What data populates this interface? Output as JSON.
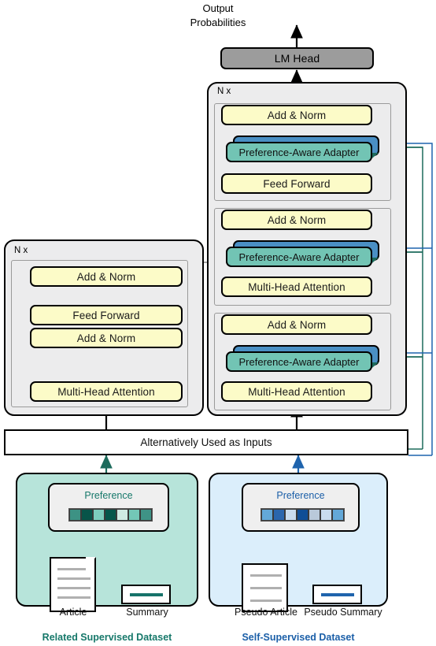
{
  "diagram": {
    "title_top_line1": "Output",
    "title_top_line2": "Probabilities",
    "lm_head": "LM Head",
    "encoder": {
      "repeat_label": "N x",
      "blocks": [
        {
          "label": "Add & Norm"
        },
        {
          "label": "Feed Forward"
        },
        {
          "label": "Add & Norm"
        },
        {
          "label": "Multi-Head Attention"
        }
      ]
    },
    "decoder": {
      "repeat_label": "N x",
      "blocks": [
        {
          "label": "Add & Norm",
          "kind": "norm"
        },
        {
          "label": "Preference-Aware Adapter",
          "kind": "adapter"
        },
        {
          "label": "Feed Forward",
          "kind": "ff"
        },
        {
          "label": "Add & Norm",
          "kind": "norm"
        },
        {
          "label": "Preference-Aware Adapter",
          "kind": "adapter"
        },
        {
          "label": "Multi-Head Attention",
          "kind": "attn"
        },
        {
          "label": "Add & Norm",
          "kind": "norm"
        },
        {
          "label": "Preference-Aware Adapter",
          "kind": "adapter"
        },
        {
          "label": "Multi-Head Attention",
          "kind": "attn"
        }
      ]
    },
    "input_bar": "Alternatively Used as Inputs",
    "datasets": [
      {
        "id": "related-supervised",
        "title": "Related Supervised Dataset",
        "title_color": "#16786a",
        "panel_color": "#b7e4da",
        "accent": "#1d6b5c",
        "preference_label": "Preference",
        "preference_values": [
          "#3d9284",
          "#075449",
          "#7dcdbd",
          "#05564a",
          "#cfeae3",
          "#73c7b7",
          "#3f9386"
        ],
        "left_caption": "Article",
        "right_caption": "Summary"
      },
      {
        "id": "self-supervised",
        "title": "Self-Supervised Dataset",
        "title_color": "#1b5fa8",
        "panel_color": "#dbeefb",
        "accent": "#1f64ad",
        "preference_label": "Preference",
        "preference_values": [
          "#63a8d8",
          "#2a66ad",
          "#c9dcee",
          "#0f4e96",
          "#b9c9da",
          "#c9dcee",
          "#63a8d8"
        ],
        "left_caption": "Pseudo Article",
        "right_caption": "Pseudo Summary"
      }
    ],
    "colors": {
      "adapter_front": "#72c4b4",
      "adapter_back": "#4a8fc4",
      "block_yellow": "#fcfbc8",
      "lm_head_grey": "#9c9c9c",
      "group_grey": "#ececed",
      "teal_line": "#1d6b5c",
      "blue_line": "#1f64ad"
    }
  }
}
